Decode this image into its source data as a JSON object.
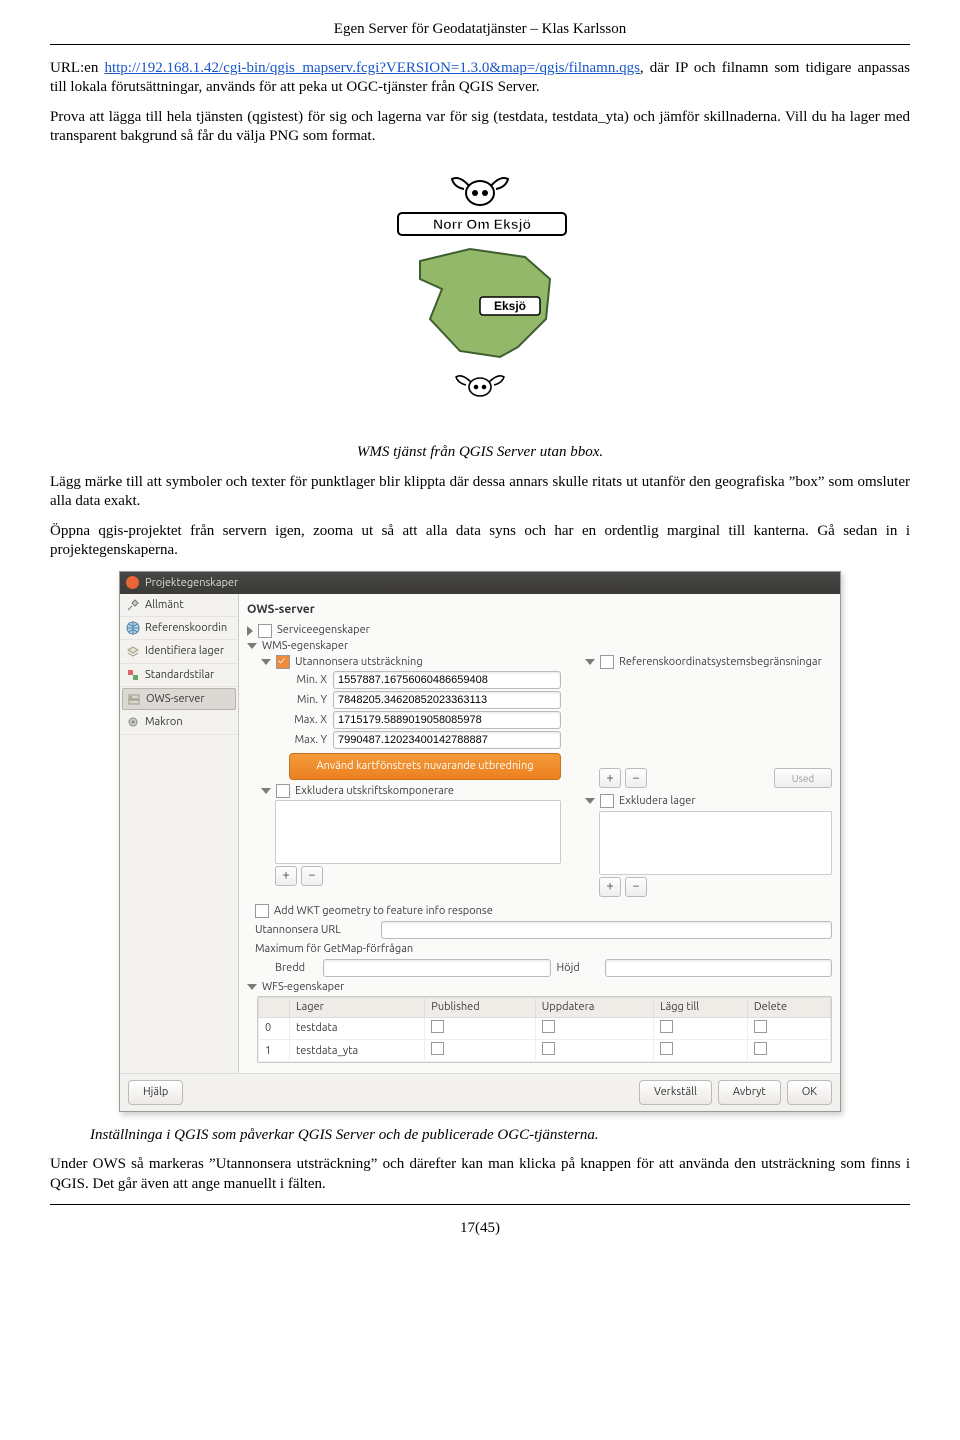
{
  "header": "Egen Server för Geodatatjänster – Klas Karlsson",
  "body": {
    "p1a": "URL:en ",
    "url": "http://192.168.1.42/cgi-bin/qgis_mapserv.fcgi?VERSION=1.3.0&map=/qgis/filnamn.qgs",
    "p1b": ", där IP och filnamn som tidigare anpassas till lokala förutsättningar, används för att peka ut OGC-tjänster från QGIS Server.",
    "p2": "Prova att lägga till hela tjänsten (qgistest) för sig och lagerna var för sig (testdata, testdata_yta) och jämför skillnaderna. Vill du ha lager med transparent bakgrund så får du välja PNG som format.",
    "img1_caption": "WMS tjänst från QGIS Server utan bbox.",
    "p3": "Lägg märke till att symboler och texter för punktlager blir klippta där dessa annars skulle ritats ut utanför den geografiska ”box” som omsluter alla data exakt.",
    "p4": "Öppna qgis-projektet från servern igen, zooma ut så att alla data syns och har en ordentlig marginal till kanterna. Gå sedan in i projektegenskaperna.",
    "img2_caption": "Inställninga i QGIS som påverkar QGIS Server och de publicerade OGC-tjänsterna.",
    "p5": "Under OWS så markeras ”Utannonsera utsträckning” och därefter kan man klicka på knappen för att använda den utsträckning som finns i QGIS. Det går även att ange manuellt i fälten."
  },
  "map": {
    "label1": "Norr Om Eksjö",
    "label2": "Eksjö"
  },
  "dlg": {
    "title": "Projektegenskaper",
    "side": [
      "Allmänt",
      "Referenskoordin",
      "Identifiera lager",
      "Standardstilar",
      "OWS-server",
      "Makron"
    ],
    "main": {
      "heading": "OWS-server",
      "serviceprops": "Serviceegenskaper",
      "wmsprops": "WMS-egenskaper",
      "ext_ck": "Utannonsera utsträckning",
      "minx_l": "Min. X",
      "minx_v": "1557887.16756060486659408",
      "miny_l": "Min. Y",
      "miny_v": "7848205.34620852023363113",
      "maxx_l": "Max. X",
      "maxx_v": "1715179.5889019058085978",
      "maxy_l": "Max. Y",
      "maxy_v": "7990487.12023400142788887",
      "use_ext_btn": "Använd kartfönstrets nuvarande utbredning",
      "crs_ck": "Referenskoordinatsystemsbegränsningar",
      "used": "Used",
      "excl_comp": "Exkludera utskriftskomponerare",
      "excl_layer": "Exkludera lager",
      "add_wkt": "Add WKT geometry to feature info response",
      "adv_url_l": "Utannonsera URL",
      "max_getmap_l": "Maximum för GetMap-förfrågan",
      "bredd": "Bredd",
      "hojd": "Höjd",
      "wfsprops": "WFS-egenskaper",
      "wfs_cols": [
        "",
        "Lager",
        "Published",
        "Uppdatera",
        "Lägg till",
        "Delete"
      ],
      "wfs_rows": [
        {
          "i": "0",
          "name": "testdata"
        },
        {
          "i": "1",
          "name": "testdata_yta"
        }
      ]
    },
    "foot": {
      "help": "Hjälp",
      "apply": "Verkställ",
      "cancel": "Avbryt",
      "ok": "OK"
    }
  },
  "pagenum": "17(45)"
}
